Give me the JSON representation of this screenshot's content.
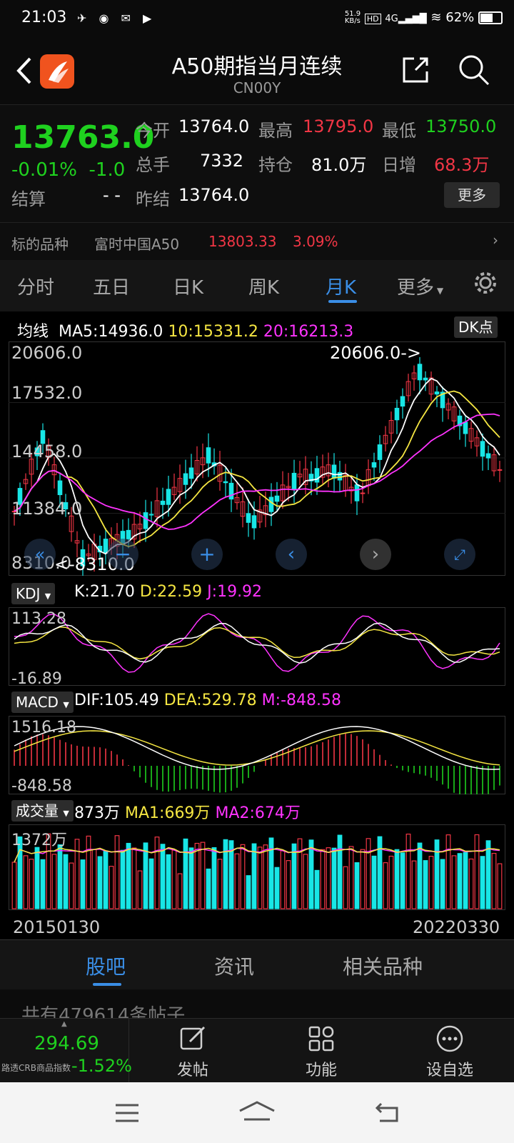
{
  "status": {
    "time": "21:03",
    "net_speed": "51.9\nKB/s",
    "battery": "62%"
  },
  "header": {
    "title": "A50期指当月连续",
    "code": "CN00Y"
  },
  "quote": {
    "price": "13763.0",
    "pct": "-0.01%",
    "change": "-1.0",
    "open_label": "今开",
    "open": "13764.0",
    "high_label": "最高",
    "high": "13795.0",
    "low_label": "最低",
    "low": "13750.0",
    "vol_label": "总手",
    "vol": "7332",
    "oi_label": "持仓",
    "oi": "81.0万",
    "daily_inc_label": "日增",
    "daily_inc": "68.3万",
    "settle_label": "结算",
    "settle": "- -",
    "prev_settle_label": "昨结",
    "prev_settle": "13764.0",
    "more": "更多"
  },
  "underlying": {
    "label": "标的品种",
    "name": "富时中国A50",
    "price": "13803.33",
    "pct": "3.09%"
  },
  "tabs": [
    {
      "label": "分时"
    },
    {
      "label": "五日"
    },
    {
      "label": "日K"
    },
    {
      "label": "周K"
    },
    {
      "label": "月K"
    },
    {
      "label": "更多"
    }
  ],
  "ma_bar": {
    "label": "均线",
    "ma5": "MA5:14936.0",
    "ma10": "10:15331.2",
    "ma20": "20:16213.3",
    "dk": "DK点"
  },
  "kline_axis": {
    "top": "20606.0",
    "y2": "17532.0",
    "y3": "14458.0",
    "y4": "11384.0",
    "bottom": "8310.0",
    "max_note": "20606.0->",
    "min_note": "<-8310.0"
  },
  "kdj": {
    "name": "KDJ",
    "k": "K:21.70",
    "d": "D:22.59",
    "j": "J:19.92",
    "top": "113.28",
    "bottom": "-16.89"
  },
  "macd": {
    "name": "MACD",
    "dif": "DIF:105.49",
    "dea": "DEA:529.78",
    "m": "M:-848.58",
    "top": "1516.18",
    "bottom": "-848.58"
  },
  "volume": {
    "name": "成交量",
    "vol": "873万",
    "ma1": "MA1:669万",
    "ma2": "MA2:674万",
    "top": "1372万"
  },
  "dates": {
    "start": "20150130",
    "end": "20220330"
  },
  "content_tabs": [
    {
      "label": "股吧"
    },
    {
      "label": "资讯"
    },
    {
      "label": "相关品种"
    }
  ],
  "post_count_text": "共有479614条帖子",
  "ticker": {
    "name": "路透CRB商品指数",
    "price": "294.69",
    "pct": "-1.52%"
  },
  "toolbar": [
    {
      "label": "发帖",
      "icon": "edit-icon"
    },
    {
      "label": "功能",
      "icon": "grid-icon"
    },
    {
      "label": "设自选",
      "icon": "more-circle-icon"
    }
  ],
  "colors": {
    "up": "#f23645",
    "down": "#1fd11f",
    "accent": "#3a8ee6",
    "cyan": "#18e6e6"
  }
}
